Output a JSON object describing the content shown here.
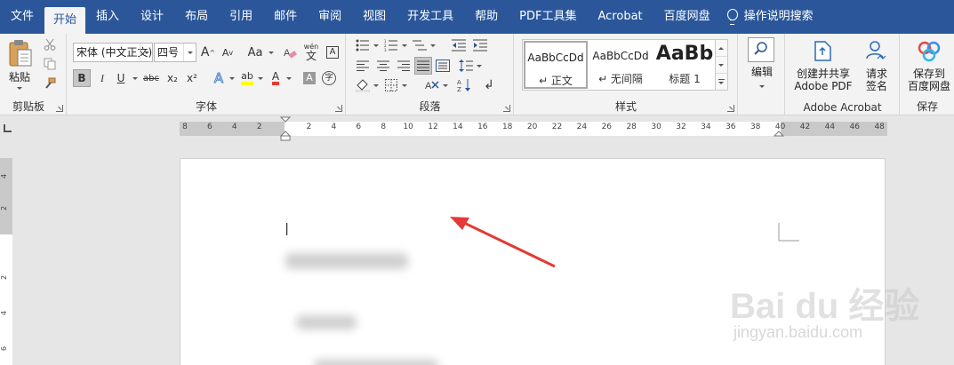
{
  "menubar": {
    "tabs": [
      "文件",
      "开始",
      "插入",
      "设计",
      "布局",
      "引用",
      "邮件",
      "审阅",
      "视图",
      "开发工具",
      "帮助",
      "PDF工具集",
      "Acrobat",
      "百度网盘"
    ],
    "active_tab": "开始",
    "tell_me": "操作说明搜索",
    "background": "#2b579a"
  },
  "clipboard": {
    "paste_label": "粘贴",
    "group_label": "剪贴板"
  },
  "font": {
    "font_name": "宋体 (中文正文)",
    "font_size": "四号",
    "grow": "A",
    "shrink": "A",
    "change_case": "Aa",
    "phonetic_top": "wén",
    "phonetic_bottom": "文",
    "bold": "B",
    "italic": "I",
    "underline": "U",
    "strikethrough": "abc",
    "subscript": "x₂",
    "superscript": "x²",
    "text_effects": "A",
    "highlight": "ab",
    "font_color": "A",
    "char_shading": "A",
    "enclosed_char": "字",
    "group_label": "字体"
  },
  "paragraph": {
    "group_label": "段落"
  },
  "styles": {
    "items": [
      {
        "sample": "AaBbCcDd",
        "name": "↵ 正文"
      },
      {
        "sample": "AaBbCcDd",
        "name": "↵ 无间隔"
      },
      {
        "sample": "AaBb",
        "name": "标题 1"
      }
    ],
    "group_label": "样式"
  },
  "editing": {
    "label": "编辑"
  },
  "adobe": {
    "create_share": "创建并共享",
    "create_share_2": "Adobe PDF",
    "request_sign": "请求",
    "request_sign_2": "签名",
    "group_label": "Adobe Acrobat"
  },
  "save": {
    "save_to": "保存到",
    "save_to_2": "百度网盘",
    "group_label": "保存"
  },
  "ruler": {
    "numbers": [
      "8",
      "6",
      "4",
      "2",
      "2",
      "4",
      "6",
      "8",
      "10",
      "12",
      "14",
      "16",
      "18",
      "20",
      "22",
      "24",
      "26",
      "28",
      "30",
      "32",
      "34",
      "36",
      "38",
      "40",
      "42",
      "44",
      "46",
      "48"
    ]
  },
  "vertical_ruler": {
    "numbers": [
      "4",
      "2",
      "2",
      "4",
      "6"
    ]
  },
  "watermark": {
    "brand": "Bai du 经验",
    "url": "jingyan.baidu.com"
  },
  "colors": {
    "accent": "#2b579a",
    "arrow": "#e53935",
    "highlight_yellow": "#ffff00",
    "font_red": "#e53935"
  }
}
